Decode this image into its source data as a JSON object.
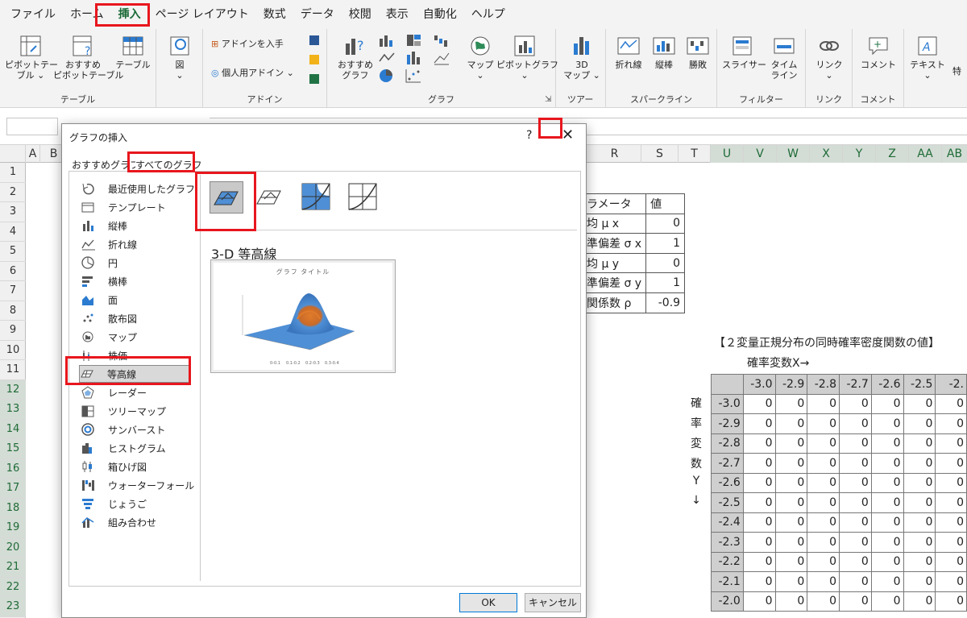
{
  "ribbon_tabs": [
    "ファイル",
    "ホーム",
    "挿入",
    "ページ レイアウト",
    "数式",
    "データ",
    "校閲",
    "表示",
    "自動化",
    "ヘルプ"
  ],
  "ribbon": {
    "tables_group": "テーブル",
    "addins_group": "アドイン",
    "charts_group": "グラフ",
    "tours_group_partial": "ツアー",
    "sparklines_group": "スパークライン",
    "filters_group": "フィルター",
    "links_group": "リンク",
    "comments_group": "コメント",
    "pivottable_l1": "ピボットテー",
    "pivottable_l2": "ブル ⌄",
    "rec_pivot_l1": "おすすめ",
    "rec_pivot_l2": "ピボットテーブル",
    "table": "テーブル",
    "illustrations": "図",
    "get_addins": "アドインを入手",
    "my_addins": "個人用アドイン",
    "rec_charts_l1": "おすすめ",
    "rec_charts_l2": "グラフ",
    "maps": "マップ",
    "pivotchart": "ピボットグラフ",
    "map3d_l1": "3D",
    "map3d_l2": "マップ ⌄",
    "line": "折れ線",
    "column": "縦棒",
    "winloss": "勝敗",
    "slicer": "スライサー",
    "timeline_l1": "タイム",
    "timeline_l2": "ライン",
    "link": "リンク",
    "comment": "コメント",
    "text": "テキスト",
    "special_partial": "特"
  },
  "columns": [
    "A",
    "B",
    "R",
    "S",
    "T",
    "U",
    "V",
    "W",
    "X",
    "Y",
    "Z",
    "AA",
    "AB"
  ],
  "rows": [
    "1",
    "2",
    "3",
    "4",
    "5",
    "6",
    "7",
    "8",
    "9",
    "10",
    "11",
    "12",
    "13",
    "14",
    "15",
    "16",
    "17",
    "18",
    "19",
    "20",
    "21",
    "22",
    "23"
  ],
  "param_table": {
    "header": [
      "ラメータ",
      "値"
    ],
    "rows": [
      [
        "均 μ x",
        "0"
      ],
      [
        "準偏差 σ x",
        "1"
      ],
      [
        "均 μ y",
        "0"
      ],
      [
        "準偏差 σ y",
        "1"
      ],
      [
        "関係数 ρ",
        "-0.9"
      ]
    ]
  },
  "grid_title": "【２変量正規分布の同時確率密度関数の値】",
  "grid_rx": "確率変数X→",
  "y_label_chars": [
    "確",
    "率",
    "変",
    "数",
    "Y",
    "↓"
  ],
  "grid_cols": [
    "-3.0",
    "-2.9",
    "-2.8",
    "-2.7",
    "-2.6",
    "-2.5",
    "-2."
  ],
  "grid_rows": [
    "-3.0",
    "-2.9",
    "-2.8",
    "-2.7",
    "-2.6",
    "-2.5",
    "-2.4",
    "-2.3",
    "-2.2",
    "-2.1",
    "-2.0"
  ],
  "grid_value": "0",
  "dialog": {
    "title": "グラフの挿入",
    "help": "?",
    "close": "✕",
    "tab_recommended": "おすすめグラフ",
    "tab_all": "すべてのグラフ",
    "categories": [
      "最近使用したグラフ",
      "テンプレート",
      "縦棒",
      "折れ線",
      "円",
      "横棒",
      "面",
      "散布図",
      "マップ",
      "株価",
      "等高線",
      "レーダー",
      "ツリーマップ",
      "サンバースト",
      "ヒストグラム",
      "箱ひげ図",
      "ウォーターフォール",
      "じょうご",
      "組み合わせ"
    ],
    "selected_category": "等高線",
    "subtype_name": "3-D 等高線",
    "preview_title": "グラフ タイトル",
    "preview_legend": [
      "0-0.1",
      "0.1-0.2",
      "0.2-0.3",
      "0.3-0.4"
    ],
    "ok": "OK",
    "cancel": "キャンセル"
  },
  "colors": {
    "accent_green": "#1e6b35",
    "highlight_red": "#e8161d",
    "surface_blue": "#4f8fd5",
    "surface_orange": "#e07b2a"
  }
}
